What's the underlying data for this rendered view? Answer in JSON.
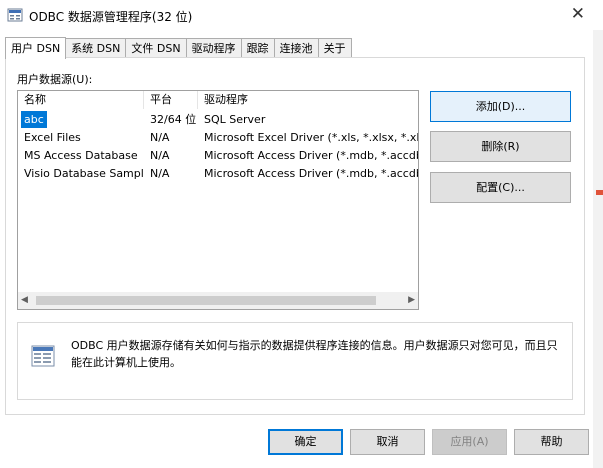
{
  "window": {
    "title": "ODBC 数据源管理程序(32 位)",
    "close_symbol": "✕"
  },
  "tabs": [
    {
      "label": "用户 DSN",
      "active": true
    },
    {
      "label": "系统 DSN",
      "active": false
    },
    {
      "label": "文件 DSN",
      "active": false
    },
    {
      "label": "驱动程序",
      "active": false
    },
    {
      "label": "跟踪",
      "active": false
    },
    {
      "label": "连接池",
      "active": false
    },
    {
      "label": "关于",
      "active": false
    }
  ],
  "user_dsn": {
    "section_label": "用户数据源(U):",
    "columns": {
      "name": "名称",
      "platform": "平台",
      "driver": "驱动程序"
    },
    "rows": [
      {
        "name": "abc",
        "platform": "32/64 位",
        "driver": "SQL Server",
        "selected": true
      },
      {
        "name": "Excel Files",
        "platform": "N/A",
        "driver": "Microsoft Excel Driver (*.xls, *.xlsx, *.xlsm, *"
      },
      {
        "name": "MS Access Database",
        "platform": "N/A",
        "driver": "Microsoft Access Driver (*.mdb, *.accdb)"
      },
      {
        "name": "Visio Database Samples",
        "platform": "N/A",
        "driver": "Microsoft Access Driver (*.mdb, *.accdb)"
      }
    ],
    "scroll_left": "◀",
    "scroll_right": "▶",
    "buttons": {
      "add": "添加(D)...",
      "remove": "删除(R)",
      "configure": "配置(C)..."
    }
  },
  "info": {
    "text": "ODBC 用户数据源存储有关如何与指示的数据提供程序连接的信息。用户数据源只对您可见，而且只能在此计算机上使用。"
  },
  "footer": {
    "ok": "确定",
    "cancel": "取消",
    "apply": "应用(A)",
    "help": "帮助"
  },
  "colors": {
    "selection": "#0078d7",
    "focus_border": "#0078d7",
    "button_face": "#e1e1e1"
  }
}
